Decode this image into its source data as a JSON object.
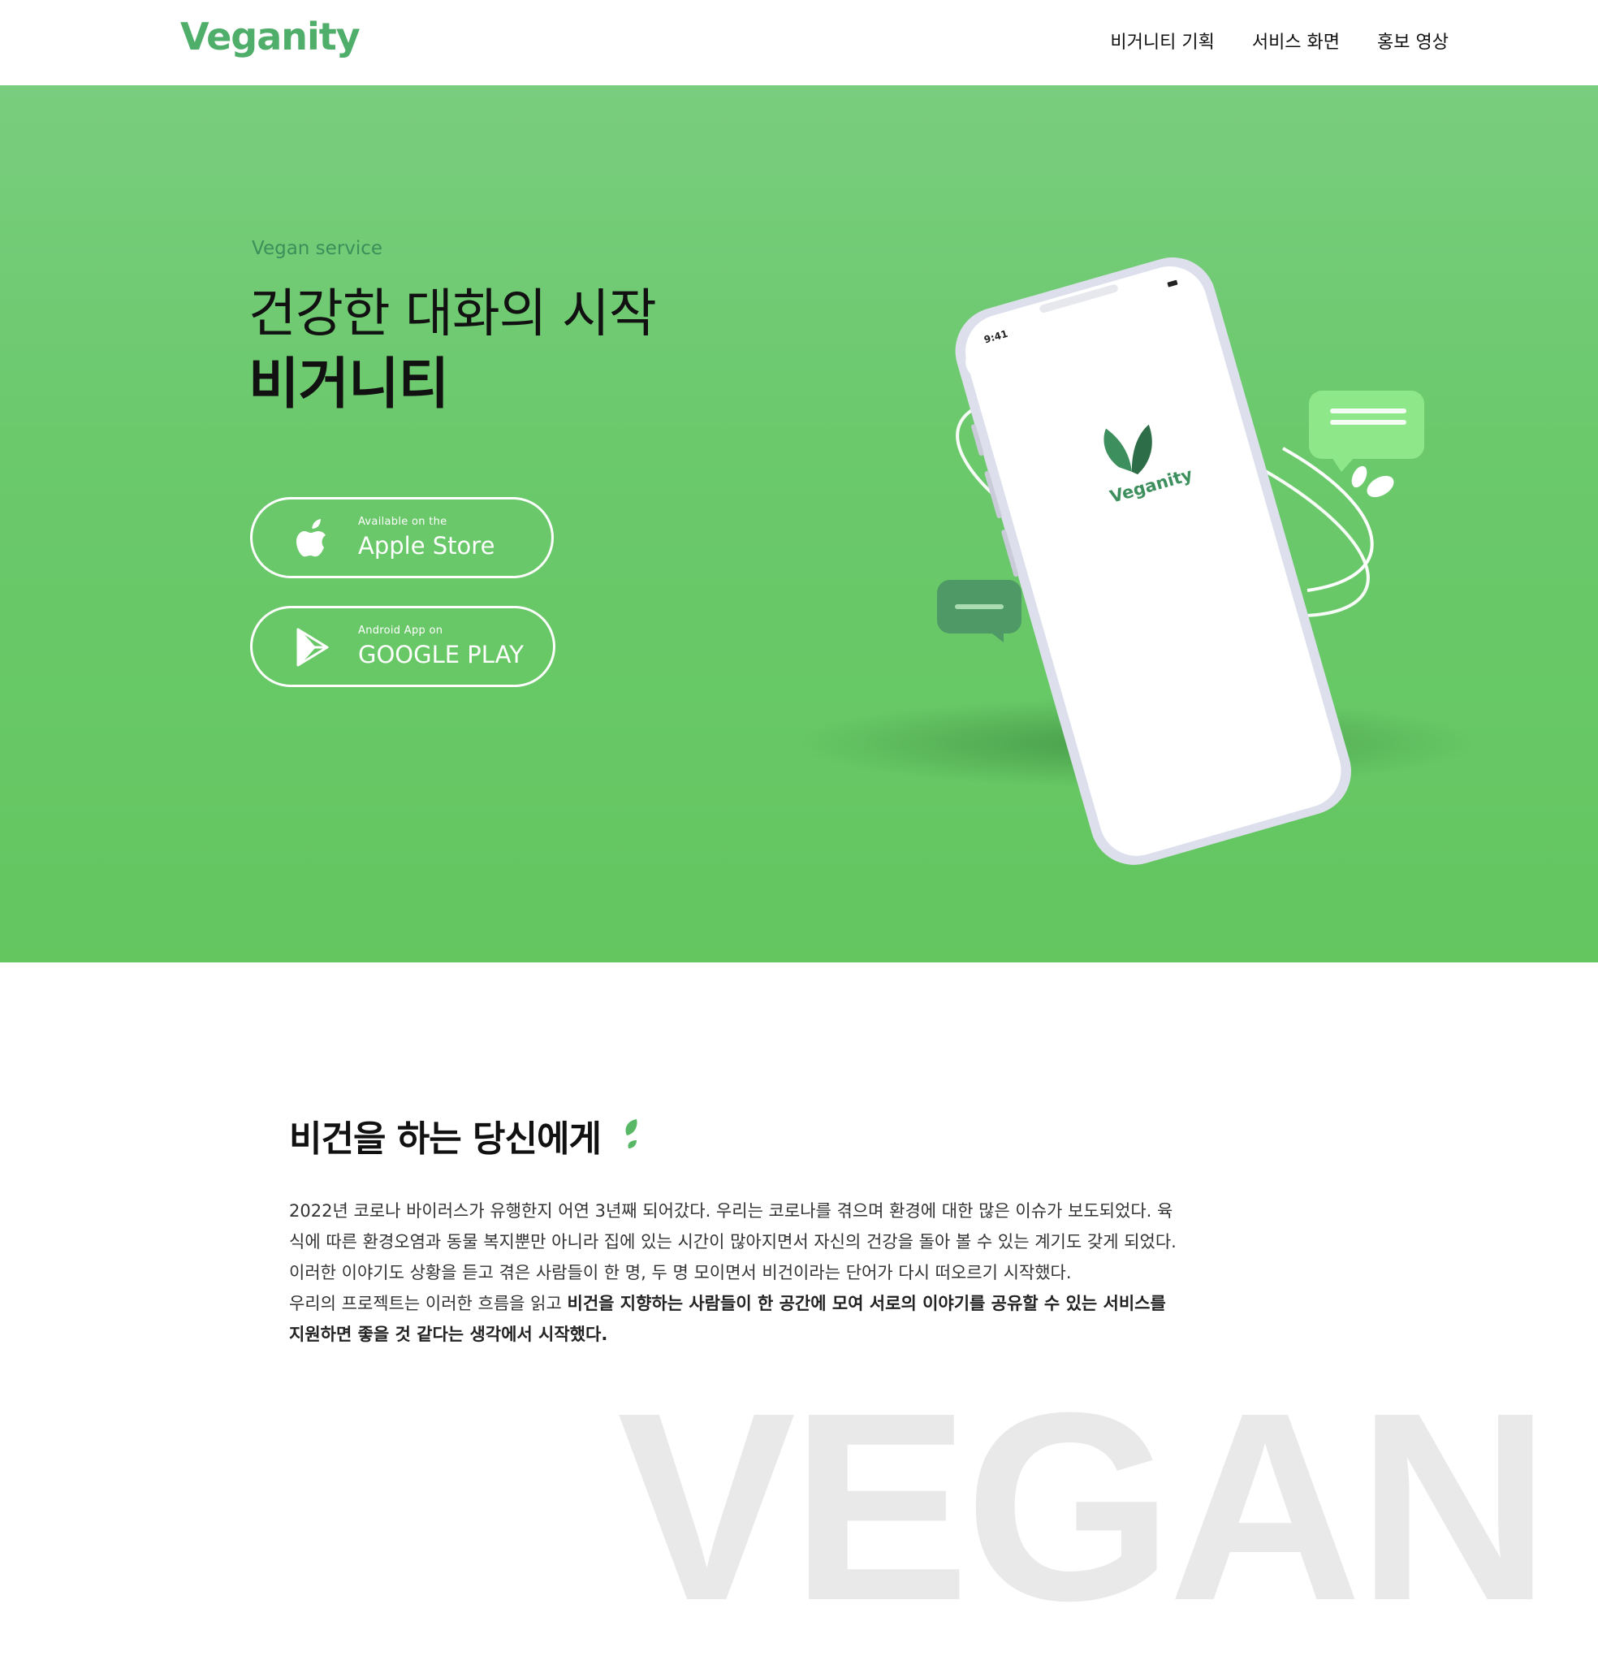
{
  "brand": {
    "name": "Veganity",
    "color": "#4fae6a",
    "accent": "#66c763"
  },
  "nav": {
    "items": [
      "비거니티 기획",
      "서비스 화면",
      "홍보 영상"
    ]
  },
  "hero": {
    "subtitle": "Vegan service",
    "title_line1": "건강한 대화의 시작",
    "title_line2": "비거니티",
    "apple": {
      "small": "Available on the",
      "big": "Apple Store",
      "icon": "apple-icon"
    },
    "google": {
      "small": "Android App on",
      "big": "GOOGLE PLAY",
      "icon": "play-icon"
    },
    "phone": {
      "time": "9:41",
      "app_name": "Veganity"
    }
  },
  "intro": {
    "title": "비건을 하는 당신에게",
    "paragraph1": "2022년 코로나 바이러스가 유행한지 어연 3년째 되어갔다. 우리는 코로나를 겪으며 환경에 대한 많은 이슈가 보도되었다. 육식에 따른 환경오염과 동물 복지뿐만 아니라 집에 있는 시간이 많아지면서 자신의 건강을 돌아 볼 수 있는 계기도 갖게 되었다. 이러한 이야기도 상황을 듣고 겪은 사람들이 한 명, 두 명 모이면서 비건이라는 단어가 다시 떠오르기 시작했다.",
    "paragraph2_plain": "우리의 프로젝트는 이러한 흐름을 읽고 ",
    "paragraph2_bold": "비건을 지향하는 사람들이 한 공간에 모여 서로의 이야기를 공유할 수 있는 서비스를 지원하면 좋을 것 같다는 생각에서 시작했다.",
    "watermark": "VEGAN"
  }
}
